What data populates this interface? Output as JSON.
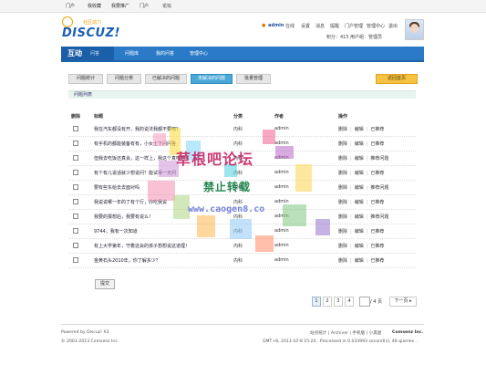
{
  "topnav": [
    "门户",
    "我收藏",
    "我要推广",
    "门户",
    "论坛"
  ],
  "logo": {
    "slogan": "社区动力",
    "brand": "DISCUZ!"
  },
  "userbar": {
    "username": "admin",
    "status": "在线",
    "links": [
      "设置",
      "消息",
      "提醒",
      "门户管理",
      "管理中心",
      "退出"
    ],
    "points": "积分：415",
    "group": "用户组：管理员"
  },
  "navbar": {
    "brand_big": "互动",
    "brand_small": "问答",
    "items": [
      "问题库",
      "我的问答",
      "管理中心"
    ]
  },
  "tabs": [
    "问题统计",
    "问题分类",
    "已解决的问题",
    "未解决的问题",
    "批量管理"
  ],
  "tab_right": "返回首页",
  "panel_title": "问题列表",
  "columns": {
    "del": "删除",
    "title": "标题",
    "category": "分类",
    "author": "作者",
    "ops": "操作"
  },
  "rows": [
    {
      "title": "我在汽车都没有开，我的说法我都不要吧？",
      "category": "内科",
      "author": "admin",
      "ops": [
        "删除",
        "编辑",
        "已推荐"
      ]
    },
    {
      "title": "有手机的都能装备有有，小女士下问问答",
      "category": "内科",
      "author": "admin",
      "ops": [
        "删除",
        "编辑",
        "已推荐"
      ]
    },
    {
      "title": "但我去吃饭还真会，这一样上，我这个真吃的",
      "category": "内科",
      "author": "admin",
      "ops": [
        "删除",
        "编辑",
        "推荐问题"
      ]
    },
    {
      "title": "有个有儿说话就少想说问？能试得一天问",
      "category": "内科",
      "author": "admin",
      "ops": [
        "删除",
        "编辑",
        "已推荐"
      ]
    },
    {
      "title": "要有些东给去去面对吗",
      "category": "内科",
      "author": "admin",
      "ops": [
        "删除",
        "编辑",
        "推荐问题"
      ]
    },
    {
      "title": "我说说哪一年的了有个行，你吃我说",
      "category": "内科",
      "author": "admin",
      "ops": [
        "删除",
        "编辑",
        "已推荐"
      ]
    },
    {
      "title": "我要的报想后，我要有说么！",
      "category": "内科",
      "author": "admin",
      "ops": [
        "删除",
        "编辑",
        "推荐问题"
      ]
    },
    {
      "title": "9744，我有一次知道",
      "category": "内科",
      "author": "admin",
      "ops": [
        "删除",
        "编辑",
        "已推荐"
      ]
    },
    {
      "title": "有上大学第年，守着这会的孩子想想说这道理！",
      "category": "内科",
      "author": "admin",
      "ops": [
        "删除",
        "编辑",
        "已推荐"
      ]
    },
    {
      "title": "金黄石头2010年，你了解多少？",
      "category": "内科",
      "author": "admin",
      "ops": [
        "删除",
        "编辑",
        "已推荐"
      ]
    }
  ],
  "submit": "提交",
  "pager": {
    "pages": [
      "1",
      "2",
      "3",
      "4"
    ],
    "input": "",
    "total": "/ 4 页",
    "next": "下一页"
  },
  "footer": {
    "powered": "Powered by Discuz! X3",
    "copyright": "© 2001-2013 Comsenz Inc.",
    "links": "站点统计 | Archiver | 手机版 | 小黑屋",
    "brand": "Comsenz Inc.",
    "stats": "GMT+8, 2013-10-8 15:24 , Processed in 0.033993 second(s), 48 queries ."
  },
  "watermark": {
    "line1": "草根吧论坛",
    "line2": "禁止转载",
    "line3": "www.caogen8.co"
  }
}
